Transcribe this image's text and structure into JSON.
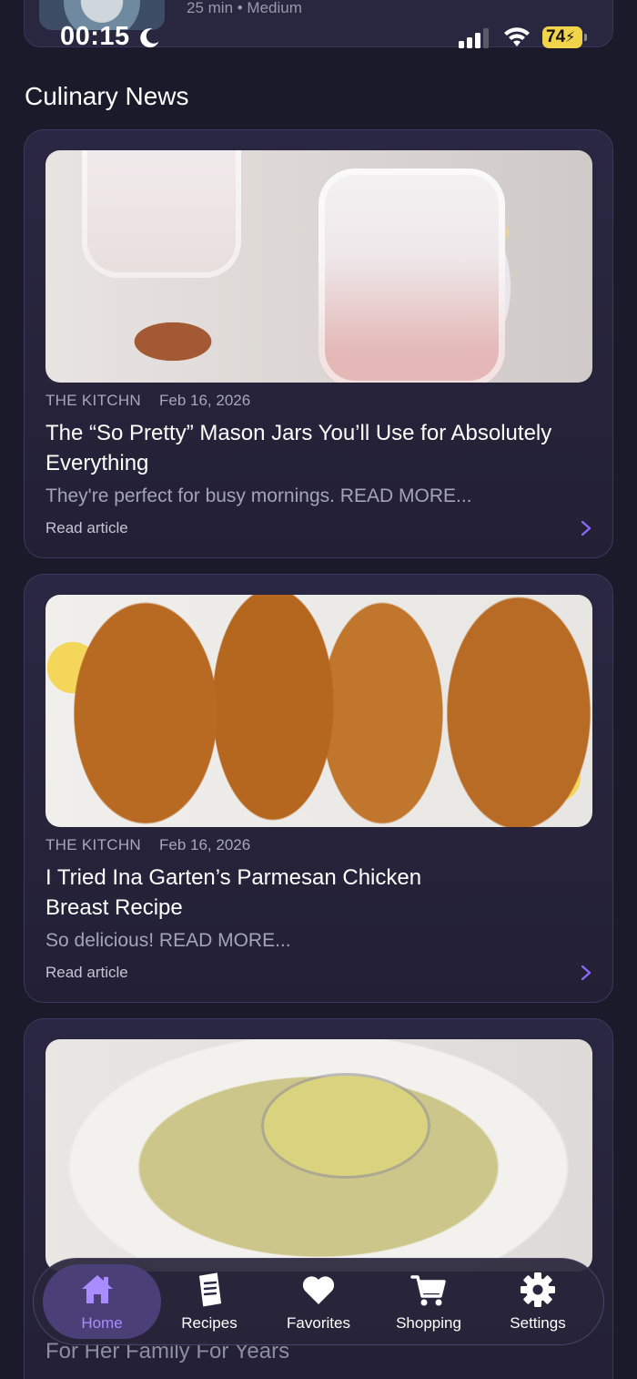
{
  "top_card": {
    "meta": "25 min • Medium"
  },
  "status_bar": {
    "time": "00:15",
    "battery": "74"
  },
  "section": {
    "title": "Culinary News"
  },
  "articles": [
    {
      "source": "THE KITCHN",
      "date": "Feb 16, 2026",
      "headline": "The “So Pretty” Mason Jars You’ll Use for Absolutely Everything",
      "description": "They're perfect for busy mornings. READ MORE...",
      "read_label": "Read article"
    },
    {
      "source": "THE KITCHN",
      "date": "Feb 16, 2026",
      "headline": "I Tried Ina Garten’s Parmesan Chicken Breast Recipe",
      "description": "So delicious! READ MORE...",
      "read_label": "Read article"
    },
    {
      "headline": "For Her Family For Years"
    }
  ],
  "tabbar": {
    "accent": "#a98cff",
    "tabs": [
      {
        "label": "Home",
        "icon": "home-icon",
        "active": true
      },
      {
        "label": "Recipes",
        "icon": "document-icon",
        "active": false
      },
      {
        "label": "Favorites",
        "icon": "heart-icon",
        "active": false
      },
      {
        "label": "Shopping",
        "icon": "cart-icon",
        "active": false
      },
      {
        "label": "Settings",
        "icon": "gear-icon",
        "active": false
      }
    ]
  }
}
